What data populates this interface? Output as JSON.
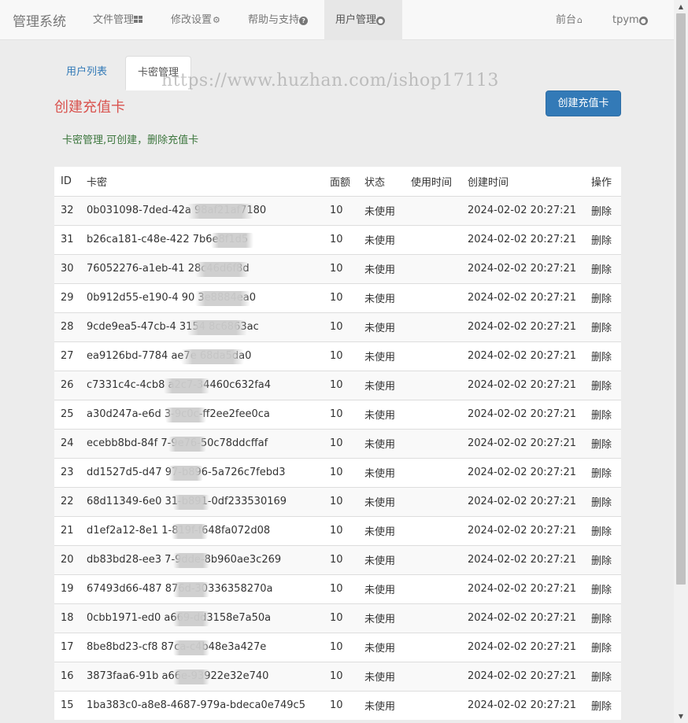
{
  "navbar": {
    "brand": "管理系统",
    "items": [
      {
        "label": "文件管理",
        "icon": "grid-icon"
      },
      {
        "label": "修改设置",
        "icon": "gear-icon"
      },
      {
        "label": "帮助与支持",
        "icon": "question-circle-icon"
      },
      {
        "label": "用户管理",
        "icon": "user-circle-icon"
      }
    ],
    "frontend": {
      "label": "前台",
      "icon": "home-icon"
    },
    "user": {
      "label": "tpym",
      "icon": "user-circle-icon"
    }
  },
  "tabs": [
    {
      "label": "用户列表",
      "active": false
    },
    {
      "label": "卡密管理",
      "active": true
    }
  ],
  "watermark": "https://www.huzhan.com/ishop17113",
  "title": "创建充值卡",
  "create_button": "创建充值卡",
  "description": "卡密管理,可创建，删除充值卡",
  "table": {
    "headers": [
      "ID",
      "卡密",
      "面额",
      "状态",
      "使用时间",
      "创建时间",
      "操作"
    ],
    "rows": [
      {
        "id": "32",
        "card": "0b031098-7ded-42a            98af21af7180",
        "amount": "10",
        "status": "未使用",
        "used": "",
        "created": "2024-02-02 20:27:21",
        "action": "删除"
      },
      {
        "id": "31",
        "card": "b26ca181-c48e-422               7b6e8f1d5",
        "amount": "10",
        "status": "未使用",
        "used": "",
        "created": "2024-02-02 20:27:21",
        "action": "删除"
      },
      {
        "id": "30",
        "card": "76052276-a1eb-41                28c46d6f8d",
        "amount": "10",
        "status": "未使用",
        "used": "",
        "created": "2024-02-02 20:27:21",
        "action": "删除"
      },
      {
        "id": "29",
        "card": "0b912d55-e190-4        90      3e8884ea0",
        "amount": "10",
        "status": "未使用",
        "used": "",
        "created": "2024-02-02 20:27:21",
        "action": "删除"
      },
      {
        "id": "28",
        "card": "9cde9ea5-47cb-4      3154      8c6863ac",
        "amount": "10",
        "status": "未使用",
        "used": "",
        "created": "2024-02-02 20:27:21",
        "action": "删除"
      },
      {
        "id": "27",
        "card": "ea9126bd-7784         ae7e       68da5da0",
        "amount": "10",
        "status": "未使用",
        "used": "",
        "created": "2024-02-02 20:27:21",
        "action": "删除"
      },
      {
        "id": "26",
        "card": "c7331c4c-4cb8          a2c7-34460c632fa4",
        "amount": "10",
        "status": "未使用",
        "used": "",
        "created": "2024-02-02 20:27:21",
        "action": "删除"
      },
      {
        "id": "25",
        "card": "a30d247a-e6d            3-9c0c-ff2ee2fee0ca",
        "amount": "10",
        "status": "未使用",
        "used": "",
        "created": "2024-02-02 20:27:21",
        "action": "删除"
      },
      {
        "id": "24",
        "card": "ecebb8bd-84f          7-9e76-50c78ddcffaf",
        "amount": "10",
        "status": "未使用",
        "used": "",
        "created": "2024-02-02 20:27:21",
        "action": "删除"
      },
      {
        "id": "23",
        "card": "dd1527d5-d47          97-b896-5a726c7febd3",
        "amount": "10",
        "status": "未使用",
        "used": "",
        "created": "2024-02-02 20:27:21",
        "action": "删除"
      },
      {
        "id": "22",
        "card": "68d11349-6e0          31-b891-0df233530169",
        "amount": "10",
        "status": "未使用",
        "used": "",
        "created": "2024-02-02 20:27:21",
        "action": "删除"
      },
      {
        "id": "21",
        "card": "d1ef2a12-8e1          1-819f-f648fa072d08",
        "amount": "10",
        "status": "未使用",
        "used": "",
        "created": "2024-02-02 20:27:21",
        "action": "删除"
      },
      {
        "id": "20",
        "card": "db83bd28-ee3          7-9dde-8b960ae3c269",
        "amount": "10",
        "status": "未使用",
        "used": "",
        "created": "2024-02-02 20:27:21",
        "action": "删除"
      },
      {
        "id": "19",
        "card": "67493d66-487          876d-30336358270a",
        "amount": "10",
        "status": "未使用",
        "used": "",
        "created": "2024-02-02 20:27:21",
        "action": "删除"
      },
      {
        "id": "18",
        "card": "0cbb1971-ed0            a669-dd3158e7a50a",
        "amount": "10",
        "status": "未使用",
        "used": "",
        "created": "2024-02-02 20:27:21",
        "action": "删除"
      },
      {
        "id": "17",
        "card": "8be8bd23-cf8            87ca-c4b48e3a427e",
        "amount": "10",
        "status": "未使用",
        "used": "",
        "created": "2024-02-02 20:27:21",
        "action": "删除"
      },
      {
        "id": "16",
        "card": "3873faa6-91b            a66e-93922e32e740",
        "amount": "10",
        "status": "未使用",
        "used": "",
        "created": "2024-02-02 20:27:21",
        "action": "删除"
      },
      {
        "id": "15",
        "card": "1ba383c0-a8e8-4687-979a-bdeca0e749c5",
        "amount": "10",
        "status": "未使用",
        "used": "",
        "created": "2024-02-02 20:27:21",
        "action": "删除"
      }
    ]
  }
}
